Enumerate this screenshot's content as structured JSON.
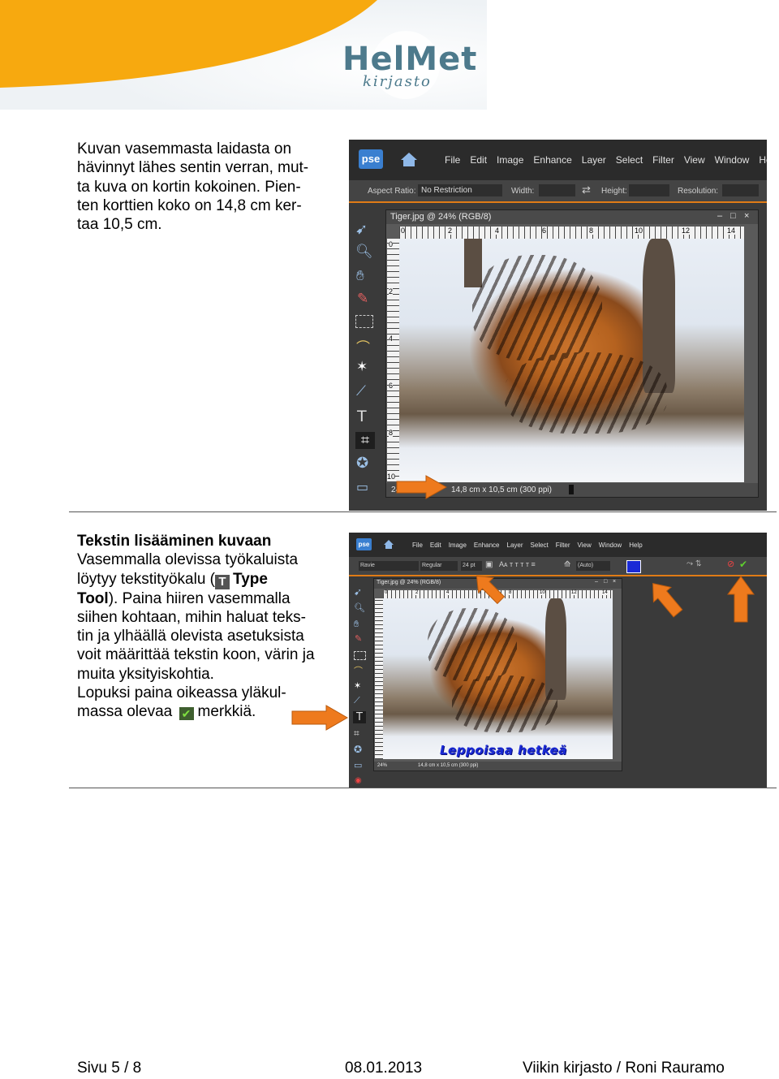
{
  "header": {
    "logo_title": "HelMet",
    "logo_subtitle": "kirjasto"
  },
  "section1": {
    "lines": [
      "Kuvan vasemmasta laidasta on",
      "hävinnyt lähes sentin verran, mut-",
      "ta kuva on kortin kokoinen. Pien-",
      "ten korttien koko on 14,8 cm ker-",
      "taa 10,5 cm."
    ]
  },
  "screenshot1": {
    "logo": "pse",
    "menu": [
      "File",
      "Edit",
      "Image",
      "Enhance",
      "Layer",
      "Select",
      "Filter",
      "View",
      "Window",
      "Hel"
    ],
    "aspect_label": "Aspect Ratio:",
    "aspect_value": "No Restriction",
    "width_label": "Width:",
    "height_label": "Height:",
    "resolution_label": "Resolution:",
    "doc_title": "Tiger.jpg @ 24% (RGB/8)",
    "ruler_ticks": [
      "0",
      "2",
      "4",
      "6",
      "8",
      "10",
      "12",
      "14"
    ],
    "vruler_ticks": [
      "0",
      "2",
      "4",
      "6",
      "8",
      "10"
    ],
    "zoom": "24",
    "status": "14,8 cm x 10,5 cm (300 ppi)",
    "win_controls": [
      "–",
      "□",
      "×"
    ]
  },
  "section2": {
    "heading": "Tekstin lisääminen kuvaan",
    "line1": "Vasemmalla olevissa työkaluista",
    "line2_a": "löytyy tekstityökalu (",
    "tool_icon": "T",
    "line2_b": "Type",
    "line3_a": "Tool",
    "line3_b": "). Paina hiiren vasemmalla",
    "lines_rest": [
      "siihen kohtaan, mihin haluat teks-",
      "tin ja ylhäällä olevista asetuksista",
      "voit määrittää tekstin koon, värin ja",
      "muita yksityiskohtia.",
      "Lopuksi paina oikeassa yläkul-"
    ],
    "last_a": "massa olevaa",
    "last_b": "merkkiä."
  },
  "screenshot2": {
    "logo": "pse",
    "menu": [
      "File",
      "Edit",
      "Image",
      "Enhance",
      "Layer",
      "Select",
      "Filter",
      "View",
      "Window",
      "Help"
    ],
    "font_value": "Ravie",
    "style_value": "Regular",
    "size_value": "24 pt",
    "leading_value": "(Auto)",
    "doc_title": "Tiger.jpg @ 24% (RGB/8)",
    "ruler_ticks": [
      "0",
      "2",
      "4",
      "6",
      "8",
      "10",
      "12",
      "14"
    ],
    "overlay_text": "Leppoisaa hetkeä",
    "zoom": "24%",
    "status": "14,8 cm x 10,5 cm (300 ppi)",
    "text_color": "#1a2ad6",
    "accent_color": "#e07b16"
  },
  "footer": {
    "page": "Sivu 5 / 8",
    "date": "08.01.2013",
    "author": "Viikin kirjasto / Roni Rauramo"
  }
}
